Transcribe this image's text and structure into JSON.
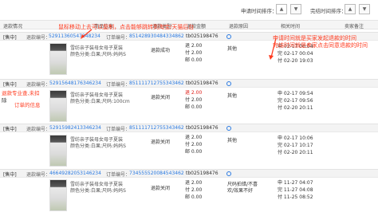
{
  "sort": {
    "apply_time_label": "申请时间排序：",
    "finish_time_label": "完结时间排序：",
    "up": "▲",
    "down": "▼"
  },
  "columns": [
    "退款情况",
    "商品信息",
    "退款类型",
    "退款金额",
    "退款原因",
    "相关时间",
    "卖家备注"
  ],
  "annotations": {
    "top": "鼠标移动上去可以复制，点击能够跳转到淘宝/天猫后台",
    "right_line1": "申请时间就是买家发起退款的时间",
    "right_line2": "完结时间就是卖家点击同意退款的时间",
    "left_line1": "退款专业查,未扣",
    "left_line2": "除",
    "left_line3": "订单的信息"
  },
  "labels": {
    "refund_no": "退款编号：",
    "order_no": "订单编号："
  },
  "orders": [
    {
      "status": "[售中]",
      "refund_no": "52911360547348234",
      "order_no": "851428930484334862",
      "tb": "tb025198476",
      "product_line1": "雪纺亲子装母女母子夏装",
      "product_line2": "颜色分类:白果;尺码:妈妈S",
      "refund_status": "退款成功",
      "amt1": "退 2.00",
      "amt2": "付 2.00",
      "amt3": "邮 0.00",
      "reason": "其他",
      "t1": "申 02-17 00:04",
      "t2": "完 02-17 00:04",
      "t3": "付 02-20 19:03"
    },
    {
      "status": "[售中]",
      "refund_no": "52915648176346234",
      "order_no": "851111712755343462",
      "tb": "tb025198476",
      "product_line1": "雪纺亲子装母女母子夏装",
      "product_line2": "颜色分类:白果;尺码:100cm",
      "refund_status": "退款关闭",
      "amt1": "退 2.00",
      "amt2": "付 2.00",
      "amt3": "邮 0.00",
      "reason": "其他",
      "t1": "申 02-17 09:54",
      "t2": "完 02-17 09:56",
      "t3": "付 02-20 20:11"
    },
    {
      "status": "[售中]",
      "refund_no": "52915982413346234",
      "order_no": "851111712755343462",
      "tb": "tb025198476",
      "product_line1": "雪纺亲子装母女母子夏装",
      "product_line2": "颜色分类:白果;尺码:妈妈S",
      "refund_status": "退款关闭",
      "amt1": "退 2.00",
      "amt2": "付 2.00",
      "amt3": "邮 0.00",
      "reason": "其他",
      "t1": "申 02-17 10:06",
      "t2": "完 02-17 10:17",
      "t3": "付 02-20 20:11"
    },
    {
      "status": "[售中]",
      "refund_no": "46649282053146234",
      "order_no": "734555520084543462",
      "tb": "tb025198476",
      "product_line1": "雪纺亲子装母女母子夏装",
      "product_line2": "颜色分类:白果;尺码:妈妈S",
      "refund_status": "退款关闭",
      "amt1": "退 2.00",
      "amt2": "付 2.00",
      "amt3": "邮 0.00",
      "reason": "尺码拍错/不喜欢/效果不好",
      "t1": "申 11-27 04:07",
      "t2": "完 11-27 04:08",
      "t3": "付 11-25 08:52"
    }
  ]
}
